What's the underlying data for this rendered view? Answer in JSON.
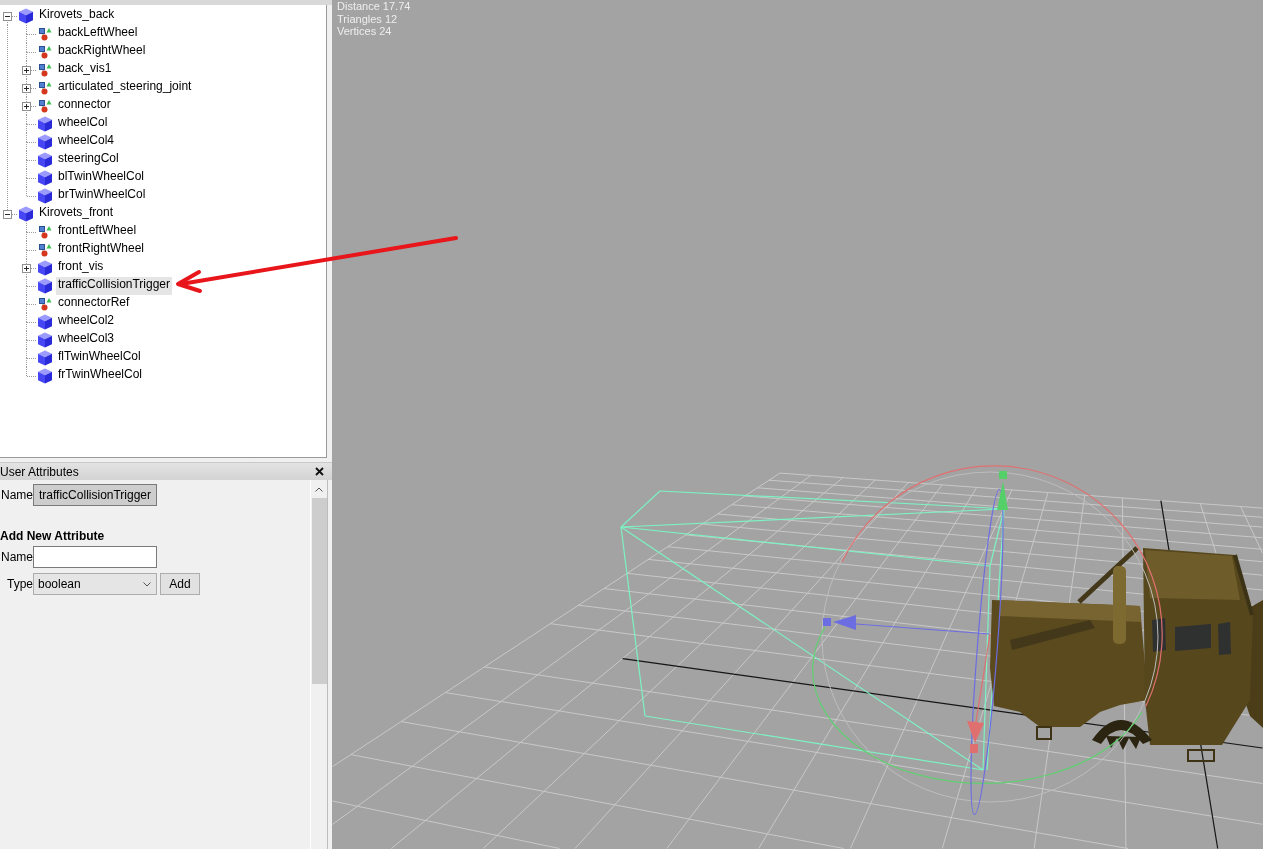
{
  "scenegraph": {
    "nodes": [
      {
        "label": "Kirovets_back",
        "kind": "shape",
        "expanded": true,
        "selected": false,
        "children": [
          {
            "label": "backLeftWheel",
            "kind": "transform",
            "selected": false
          },
          {
            "label": "backRightWheel",
            "kind": "transform",
            "selected": false
          },
          {
            "label": "back_vis1",
            "kind": "transform",
            "expanded": false,
            "selected": false
          },
          {
            "label": "articulated_steering_joint",
            "kind": "transform",
            "expanded": false,
            "selected": false
          },
          {
            "label": "connector",
            "kind": "transform",
            "expanded": false,
            "selected": false
          },
          {
            "label": "wheelCol",
            "kind": "shape",
            "selected": false
          },
          {
            "label": "wheelCol4",
            "kind": "shape",
            "selected": false
          },
          {
            "label": "steeringCol",
            "kind": "shape",
            "selected": false
          },
          {
            "label": "blTwinWheelCol",
            "kind": "shape",
            "selected": false
          },
          {
            "label": "brTwinWheelCol",
            "kind": "shape",
            "selected": false
          }
        ]
      },
      {
        "label": "Kirovets_front",
        "kind": "shape",
        "expanded": true,
        "selected": false,
        "children": [
          {
            "label": "frontLeftWheel",
            "kind": "transform",
            "selected": false
          },
          {
            "label": "frontRightWheel",
            "kind": "transform",
            "selected": false
          },
          {
            "label": "front_vis",
            "kind": "shape",
            "expanded": false,
            "selected": false
          },
          {
            "label": "trafficCollisionTrigger",
            "kind": "shape",
            "selected": true
          },
          {
            "label": "connectorRef",
            "kind": "transform",
            "selected": false
          },
          {
            "label": "wheelCol2",
            "kind": "shape",
            "selected": false
          },
          {
            "label": "wheelCol3",
            "kind": "shape",
            "selected": false
          },
          {
            "label": "flTwinWheelCol",
            "kind": "shape",
            "selected": false
          },
          {
            "label": "frTwinWheelCol",
            "kind": "shape",
            "selected": false
          }
        ]
      }
    ]
  },
  "user_attributes": {
    "title": "User Attributes",
    "name_label": "Name",
    "name_value": "trafficCollisionTrigger",
    "add_heading": "Add New Attribute",
    "new_name_label": "Name",
    "type_label": "Type",
    "type_value": "boolean",
    "add_button": "Add"
  },
  "viewport": {
    "stats": [
      "Distance 17.74",
      "Triangles 12",
      "Vertices 24"
    ]
  }
}
